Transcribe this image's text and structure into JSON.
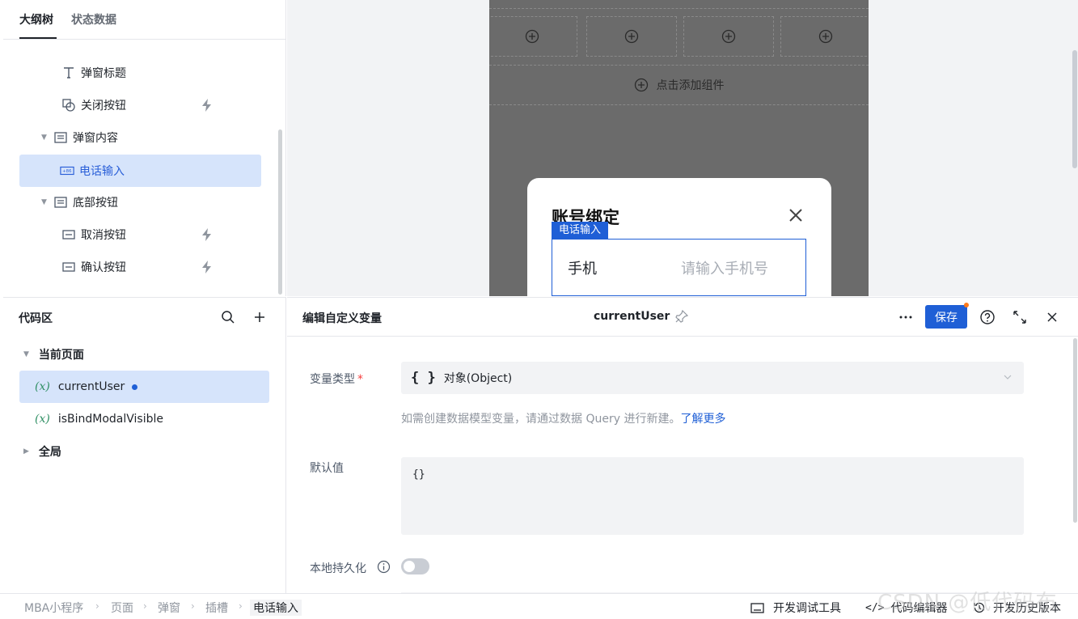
{
  "outline": {
    "tabs": [
      "大纲树",
      "状态数据"
    ],
    "items": [
      {
        "label": "弹窗标题",
        "icon": "text-icon"
      },
      {
        "label": "关闭按钮",
        "icon": "shapes-icon",
        "has_event": true
      },
      {
        "label": "弹窗内容",
        "icon": "container-icon",
        "expanded": true
      },
      {
        "label": "电话输入",
        "icon": "phone-input-icon",
        "selected": true
      },
      {
        "label": "底部按钮",
        "icon": "container-icon",
        "expanded": true
      },
      {
        "label": "取消按钮",
        "icon": "button-icon",
        "has_event": true
      },
      {
        "label": "确认按钮",
        "icon": "button-icon",
        "has_event": true
      }
    ]
  },
  "code_area": {
    "title": "代码区",
    "groups": {
      "current": "当前页面",
      "global": "全局"
    },
    "var_symbol": "(x)",
    "variables": [
      {
        "name": "currentUser",
        "selected": true,
        "modified": true
      },
      {
        "name": "isBindModalVisible",
        "selected": false
      }
    ]
  },
  "canvas": {
    "add_component": "点击添加组件",
    "modal": {
      "title": "账号绑定",
      "selected_tag": "电话输入",
      "phone_label": "手机",
      "phone_placeholder": "请输入手机号"
    }
  },
  "editor": {
    "title": "编辑自定义变量",
    "var_name": "currentUser",
    "save_label": "保存",
    "fields": {
      "type_label": "变量类型",
      "type_value": "对象(Object)",
      "hint_text": "如需创建数据模型变量，请通过数据 Query 进行新建。",
      "hint_link": "了解更多",
      "default_label": "默认值",
      "default_value": "{}",
      "persist_label": "本地持久化",
      "persist_on": false
    }
  },
  "bottom_bar": {
    "breadcrumb": [
      "MBA小程序",
      "页面",
      "弹窗",
      "插槽",
      "电话输入"
    ],
    "tools": [
      "开发调试工具",
      "代码编辑器",
      "开发历史版本"
    ]
  },
  "watermark": "CSDN @低代码布道师",
  "colors": {
    "accent": "#1f5fd6",
    "selected_bg": "#d6e4fb",
    "modified_dot": "#ff7a1a"
  }
}
